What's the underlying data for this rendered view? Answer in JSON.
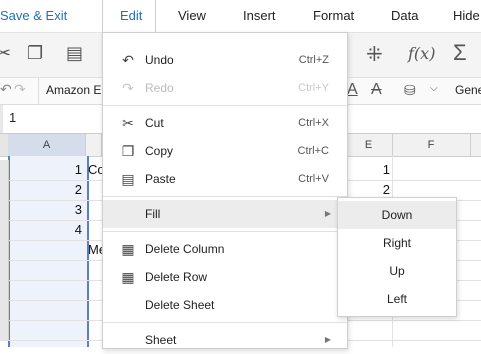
{
  "menubar": {
    "save_exit": "Save & Exit",
    "items": [
      {
        "label": "Edit"
      },
      {
        "label": "View"
      },
      {
        "label": "Insert"
      },
      {
        "label": "Format"
      },
      {
        "label": "Data"
      },
      {
        "label": "Hide"
      }
    ],
    "active": "Edit",
    "accent_color": "#1f6fb9"
  },
  "toolbar": {
    "font_name": "Amazon E",
    "number_format": "Gene"
  },
  "formula_bar": {
    "value": "1"
  },
  "grid": {
    "column_headers": [
      "A",
      "E",
      "F"
    ],
    "rows": [
      {
        "a": "1",
        "b": "Co",
        "e": "1"
      },
      {
        "a": "2",
        "b": "",
        "e": "2"
      },
      {
        "a": "3",
        "b": "",
        "e": ""
      },
      {
        "a": "4",
        "b": "",
        "e": ""
      },
      {
        "a": "",
        "b": "Me",
        "e": ""
      }
    ]
  },
  "edit_menu": {
    "undo": {
      "label": "Undo",
      "shortcut": "Ctrl+Z"
    },
    "redo": {
      "label": "Redo",
      "shortcut": "Ctrl+Y"
    },
    "cut": {
      "label": "Cut",
      "shortcut": "Ctrl+X"
    },
    "copy": {
      "label": "Copy",
      "shortcut": "Ctrl+C"
    },
    "paste": {
      "label": "Paste",
      "shortcut": "Ctrl+V"
    },
    "fill": {
      "label": "Fill"
    },
    "delete_column": {
      "label": "Delete Column"
    },
    "delete_row": {
      "label": "Delete Row"
    },
    "delete_sheet": {
      "label": "Delete Sheet"
    },
    "sheet": {
      "label": "Sheet"
    }
  },
  "fill_submenu": {
    "items": [
      "Down",
      "Right",
      "Up",
      "Left"
    ]
  }
}
